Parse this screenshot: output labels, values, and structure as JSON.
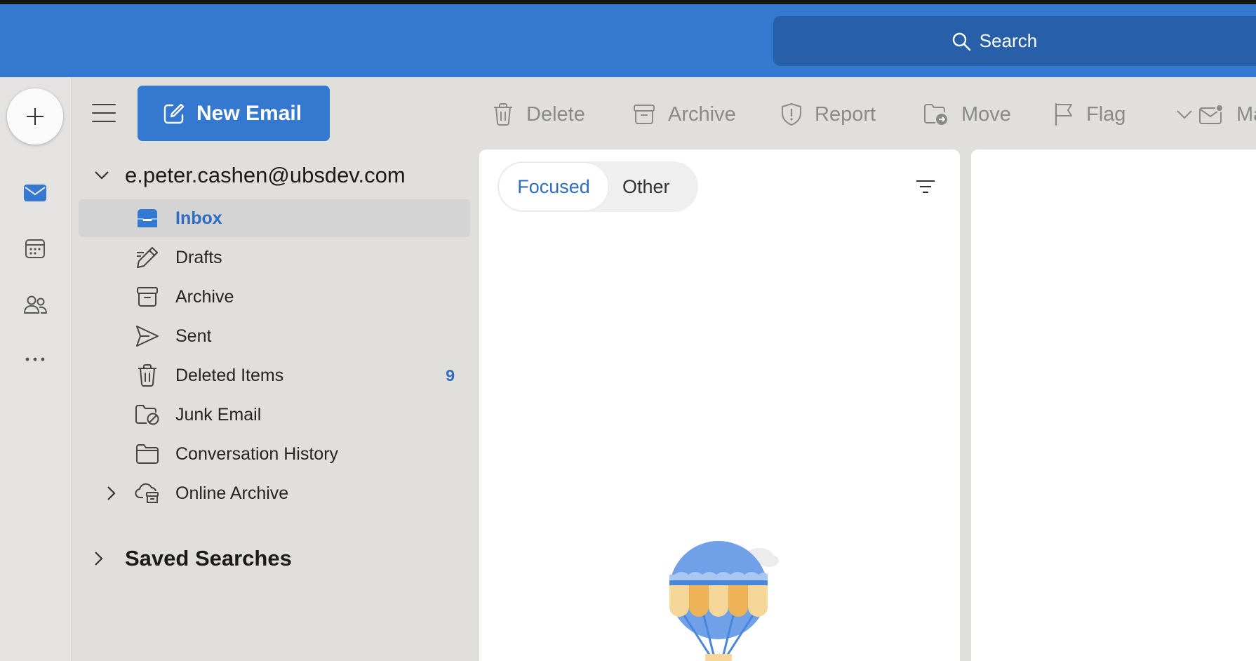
{
  "header": {
    "search_label": "Search",
    "brand_color": "#3478cf"
  },
  "rail": {
    "add_icon": "plus-icon",
    "items": [
      {
        "name": "mail",
        "icon": "mail-icon",
        "active": true
      },
      {
        "name": "calendar",
        "icon": "calendar-icon",
        "active": false
      },
      {
        "name": "people",
        "icon": "people-icon",
        "active": false
      },
      {
        "name": "more",
        "icon": "more-icon",
        "active": false
      }
    ]
  },
  "compose": {
    "new_email_label": "New Email"
  },
  "toolbar": {
    "delete_label": "Delete",
    "archive_label": "Archive",
    "report_label": "Report",
    "move_label": "Move",
    "flag_label": "Flag",
    "mark_label": "Ma"
  },
  "account": {
    "email": "e.peter.cashen@ubsdev.com"
  },
  "folders": [
    {
      "label": "Inbox",
      "icon": "inbox-icon",
      "selected": true,
      "count": ""
    },
    {
      "label": "Drafts",
      "icon": "pencil-icon",
      "selected": false,
      "count": ""
    },
    {
      "label": "Archive",
      "icon": "archive-icon",
      "selected": false,
      "count": ""
    },
    {
      "label": "Sent",
      "icon": "send-icon",
      "selected": false,
      "count": ""
    },
    {
      "label": "Deleted Items",
      "icon": "trash-icon",
      "selected": false,
      "count": "9"
    },
    {
      "label": "Junk Email",
      "icon": "junk-folder-icon",
      "selected": false,
      "count": ""
    },
    {
      "label": "Conversation History",
      "icon": "folder-icon",
      "selected": false,
      "count": ""
    },
    {
      "label": "Online Archive",
      "icon": "cloud-archive-icon",
      "selected": false,
      "count": ""
    }
  ],
  "saved_searches": {
    "label": "Saved Searches"
  },
  "message_list": {
    "tabs": [
      {
        "label": "Focused",
        "active": true
      },
      {
        "label": "Other",
        "active": false
      }
    ],
    "filter_icon": "filter-icon",
    "empty_illustration": "hot-air-balloon"
  }
}
